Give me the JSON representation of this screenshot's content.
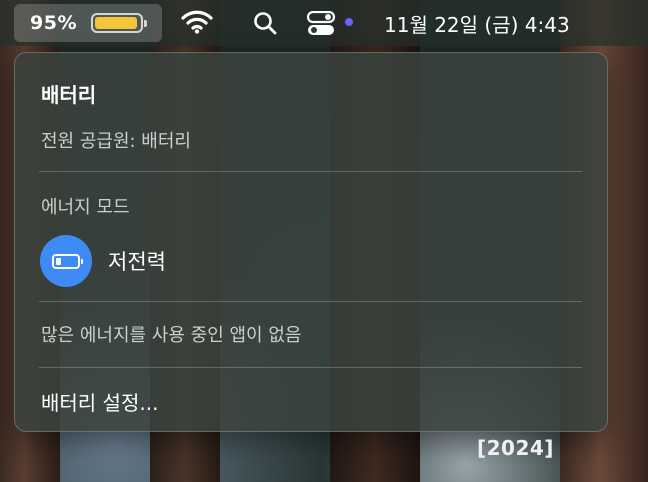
{
  "menubar": {
    "battery_percent": "95%",
    "battery_level": 0.95,
    "battery_color": "#f3c63a",
    "icons": [
      "wifi-icon",
      "search-icon",
      "control-center-icon"
    ],
    "notification_dot_color": "#6a63f5",
    "clock": "11월 22일 (금) 4:43"
  },
  "panel": {
    "title": "배터리",
    "power_source": "전원 공급원: 배터리",
    "energy_mode_header": "에너지 모드",
    "energy_mode": {
      "label": "저전력",
      "icon": "low-battery-icon",
      "accent": "#3f8bf5"
    },
    "no_apps_text": "많은 에너지를 사용 중인 앱이 없음",
    "settings_label": "배터리 설정..."
  },
  "wallpaper": {
    "stamp": "[2024]"
  }
}
